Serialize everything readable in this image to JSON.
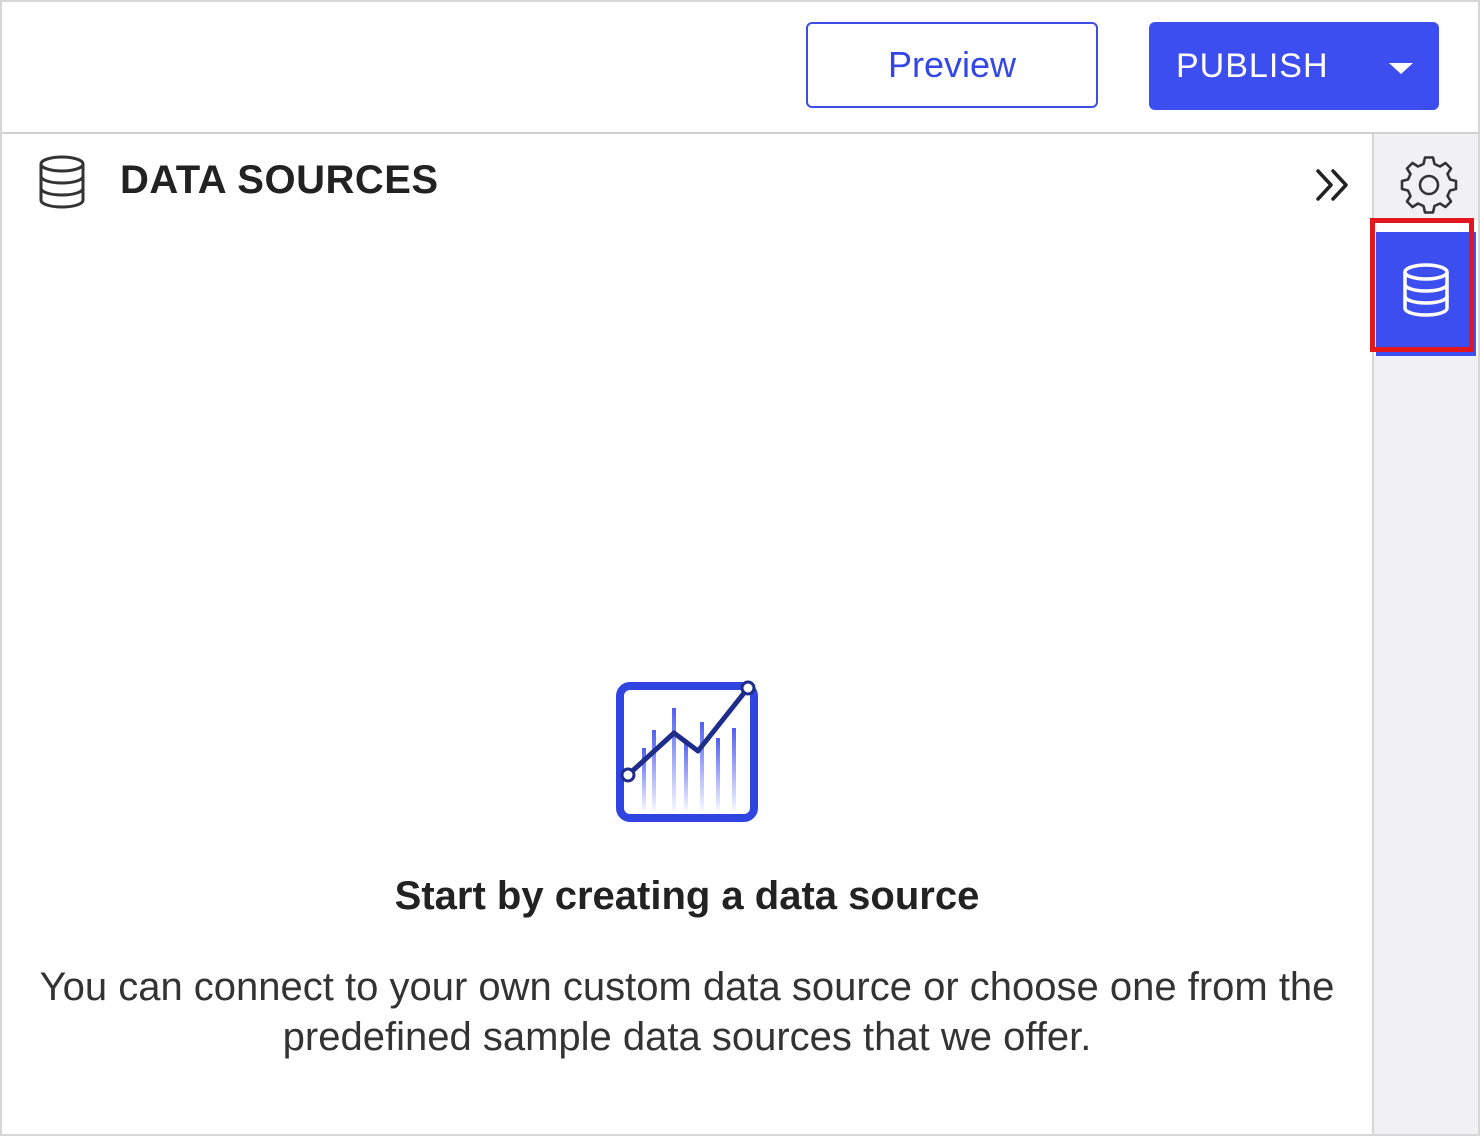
{
  "toolbar": {
    "preview_label": "Preview",
    "publish_label": "PUBLISH",
    "publish_dropdown_icon": "caret-down-icon"
  },
  "panel": {
    "title": "DATA SOURCES",
    "title_icon": "database-icon",
    "collapse_icon": "double-chevron-right-icon"
  },
  "empty_state": {
    "illustration_icon": "line-chart-icon",
    "title": "Start by creating a data source",
    "description": "You can connect to your own custom data source or choose one from the predefined sample data sources that we offer."
  },
  "rail": {
    "items": [
      {
        "icon": "gear-icon",
        "active": false
      },
      {
        "icon": "database-icon",
        "active": true
      }
    ]
  },
  "colors": {
    "accent": "#3d4ef0",
    "highlight": "#e3161e",
    "rail_bg": "#f1f1f3"
  }
}
